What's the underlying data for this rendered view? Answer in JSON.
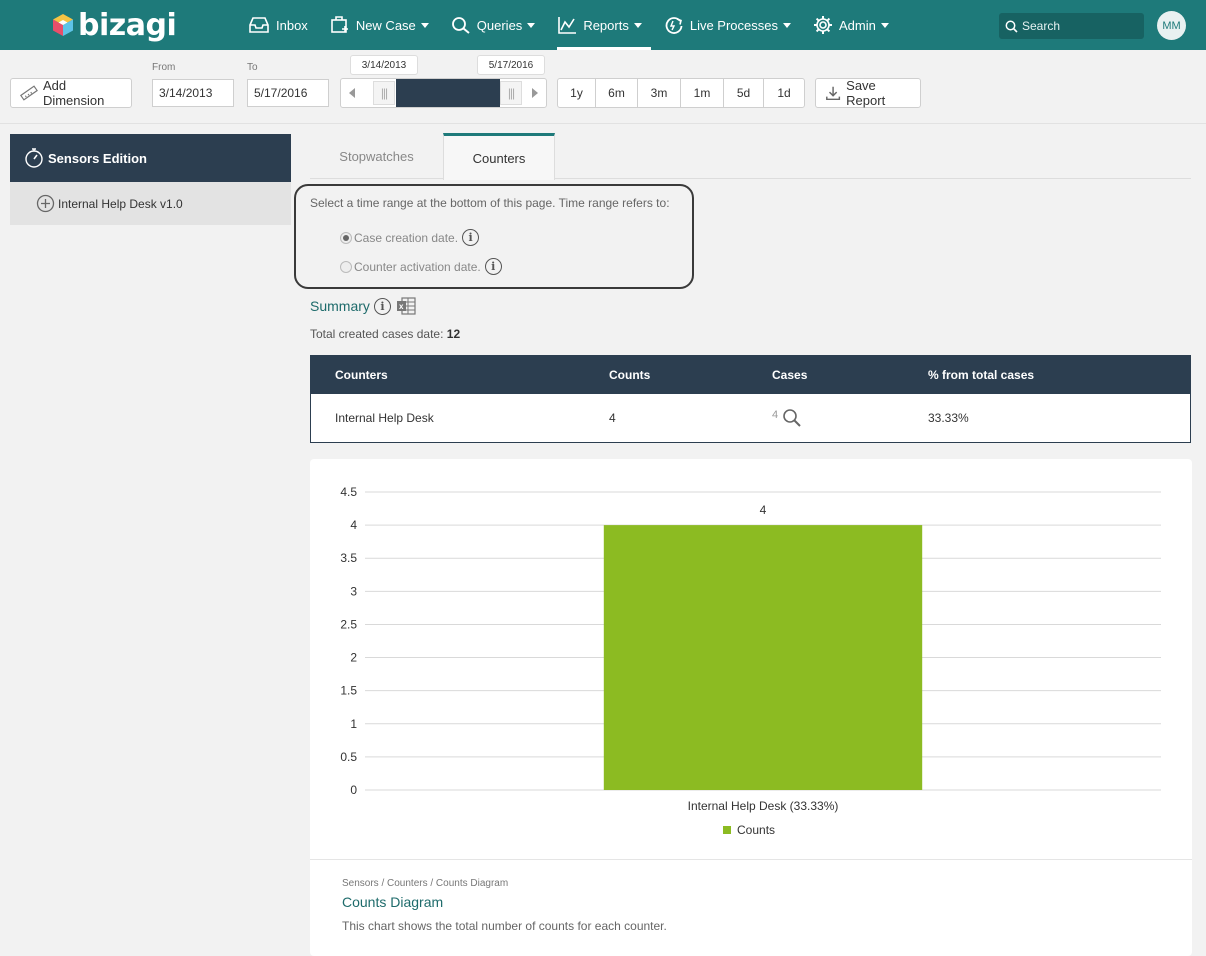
{
  "brand": {
    "name": "bizagi"
  },
  "nav": {
    "inbox": "Inbox",
    "new_case": "New Case",
    "queries": "Queries",
    "reports": "Reports",
    "live_processes": "Live Processes",
    "admin": "Admin"
  },
  "search": {
    "placeholder": "Search"
  },
  "user": {
    "initials": "MM"
  },
  "toolbar": {
    "add_dimension": "Add Dimension",
    "from_label": "From",
    "to_label": "To",
    "from_value": "3/14/2013",
    "to_value": "5/17/2016",
    "slider_start_tip": "3/14/2013",
    "slider_end_tip": "5/17/2016",
    "ranges": [
      "1y",
      "6m",
      "3m",
      "1m",
      "5d",
      "1d"
    ],
    "save_report": "Save Report"
  },
  "sidebar": {
    "title": "Sensors Edition",
    "items": [
      {
        "label": "Internal Help Desk v1.0"
      }
    ]
  },
  "tabs": {
    "stopwatches": "Stopwatches",
    "counters": "Counters"
  },
  "time_range": {
    "instruction": "Select a time range at the bottom of this page. Time range refers to:",
    "options": [
      {
        "label": "Case creation date.",
        "checked": true
      },
      {
        "label": "Counter activation date.",
        "checked": false
      }
    ]
  },
  "summary": {
    "title": "Summary",
    "total_label": "Total created cases date:",
    "total_value": "12"
  },
  "table": {
    "headers": [
      "Counters",
      "Counts",
      "Cases",
      "% from total cases"
    ],
    "rows": [
      {
        "counter": "Internal Help Desk",
        "counts": "4",
        "cases": "4",
        "percent": "33.33%"
      }
    ]
  },
  "chart_data": {
    "type": "bar",
    "categories": [
      "Internal Help Desk (33.33%)"
    ],
    "series": [
      {
        "name": "Counts",
        "values": [
          4
        ],
        "color": "#8cbb22"
      }
    ],
    "data_labels": [
      "4"
    ],
    "ylim": [
      0,
      4.5
    ],
    "yticks": [
      "0",
      "0.5",
      "1",
      "1.5",
      "2",
      "2.5",
      "3",
      "3.5",
      "4",
      "4.5"
    ],
    "grid": true,
    "legend": "bottom-center"
  },
  "chart_card": {
    "breadcrumb": "Sensors / Counters / Counts Diagram",
    "title": "Counts Diagram",
    "description": "This chart shows the total number of counts for each counter."
  },
  "colors": {
    "header": "#1e7a7a",
    "dark": "#2c3e50",
    "accent_bar": "#8cbb22"
  }
}
